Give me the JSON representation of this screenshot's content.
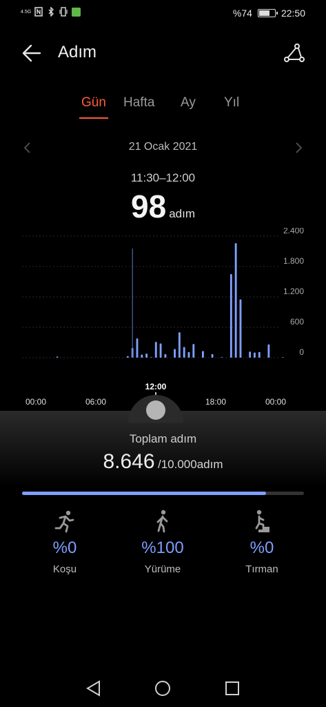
{
  "status_bar": {
    "network": "4.5G",
    "battery": "%74",
    "battery_level": 0.74,
    "time": "22:50"
  },
  "header": {
    "title": "Adım",
    "back_icon": "arrow-left-icon",
    "share_icon": "share-icon"
  },
  "tabs": [
    {
      "label": "Gün",
      "active": true
    },
    {
      "label": "Hafta",
      "active": false
    },
    {
      "label": "Ay",
      "active": false
    },
    {
      "label": "Yıl",
      "active": false
    }
  ],
  "date": {
    "label": "21 Ocak 2021"
  },
  "selection": {
    "period": "11:30–12:00",
    "value": "98",
    "unit": "adım"
  },
  "chart_data": {
    "type": "bar",
    "xlabel": "",
    "ylabel": "",
    "y_ticks": [
      "2.400",
      "1.800",
      "1.200",
      "600",
      "0"
    ],
    "ylim": [
      0,
      2400
    ],
    "x_ticks": [
      "00:00",
      "06:00",
      "12:00",
      "18:00",
      "00:00"
    ],
    "selected_tick": "12:00",
    "bar_color": "#7fa0ff",
    "values": [
      0,
      0,
      0,
      0,
      0,
      0,
      0,
      20,
      0,
      0,
      0,
      0,
      0,
      0,
      0,
      0,
      0,
      0,
      0,
      0,
      0,
      0,
      30,
      190,
      380,
      60,
      80,
      10,
      310,
      280,
      70,
      0,
      170,
      500,
      210,
      110,
      270,
      0,
      130,
      0,
      70,
      0,
      10,
      0,
      1650,
      2260,
      1150,
      0,
      120,
      100,
      110,
      0,
      260,
      0,
      0,
      10,
      0,
      0,
      0,
      0
    ]
  },
  "summary": {
    "label": "Toplam adım",
    "total": "8.646",
    "goal": "/10.000adım",
    "progress": 0.8646
  },
  "activities": [
    {
      "icon": "running-icon",
      "percent": "%0",
      "name": "Koşu"
    },
    {
      "icon": "walking-icon",
      "percent": "%100",
      "name": "Yürüme"
    },
    {
      "icon": "climbing-icon",
      "percent": "%0",
      "name": "Tırman"
    }
  ],
  "colors": {
    "accent": "#ff5a3c",
    "bar": "#7fa0ff"
  }
}
